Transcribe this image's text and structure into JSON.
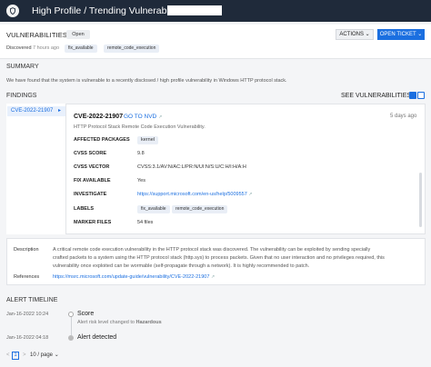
{
  "header": {
    "title": "High Profile / Trending Vulnerability"
  },
  "top": {
    "section_label": "VULNERABILITIES",
    "status_badge": "Open",
    "actions_label": "ACTIONS",
    "open_ticket_label": "OPEN TICKET",
    "discovered_label": "Discovered",
    "discovered_time": "7 hours ago",
    "tags": [
      "fix_available",
      "remote_code_execution"
    ]
  },
  "summary": {
    "title": "SUMMARY",
    "text": "We have found that the system is vulnerable to a recently disclosed / high profile vulnerability in Windows HTTP protocol stack."
  },
  "findings": {
    "title": "FINDINGS",
    "see_all": "SEE VULNERABILITIES",
    "list": [
      "CVE-2022-21907"
    ],
    "detail": {
      "cve": "CVE-2022-21907",
      "goto": "GO TO NVD",
      "age": "5 days ago",
      "description": "HTTP Protocol Stack Remote Code Execution Vulnerability.",
      "rows": [
        {
          "label": "AFFECTED PACKAGES",
          "value": "kernel"
        },
        {
          "label": "CVSS SCORE",
          "value": "9.8"
        },
        {
          "label": "CVSS VECTOR",
          "value": "CVSS:3.1/AV:N/AC:L/PR:N/UI:N/S:U/C:H/I:H/A:H"
        },
        {
          "label": "FIX AVAILABLE",
          "value": "Yes"
        },
        {
          "label": "INVESTIGATE",
          "value": "https://support.microsoft.com/en-us/help/5009557"
        },
        {
          "label": "LABELS",
          "value": ""
        },
        {
          "label": "MARKER FILES",
          "value": "54 files"
        }
      ],
      "labels": [
        "fix_available",
        "remote_code_execution"
      ]
    }
  },
  "description_card": {
    "desc_label": "Description",
    "desc_lines": [
      "A critical remote code execution vulnerability in the HTTP protocol stack was discovered. The vulnerability can be exploited by sending specially",
      "crafted packets to a system using the HTTP protocol stack (http.sys) to process packets. Given that no user interaction and no privileges required, this",
      "vulnerability once exploited can be wormable (self-propagate through a network). It is highly recommended to patch."
    ],
    "ref_label": "References",
    "ref_link": "https://msrc.microsoft.com/update-guide/vulnerability/CVE-2022-21907"
  },
  "timeline": {
    "title": "ALERT TIMELINE",
    "events": [
      {
        "date": "Jan-16-2022 10:24",
        "title": "Score",
        "sub_prefix": "Alert risk level changed to",
        "sub_value": "Hazardous"
      },
      {
        "date": "Jan-16-2022 04:18",
        "title": "Alert detected",
        "sub_prefix": "",
        "sub_value": ""
      }
    ]
  },
  "pagination": {
    "prev": "<",
    "page": "1",
    "next": ">",
    "page_size": "10 / page"
  },
  "colors": {
    "header_bg": "#1f2a3a",
    "accent": "#1b6fe0"
  }
}
